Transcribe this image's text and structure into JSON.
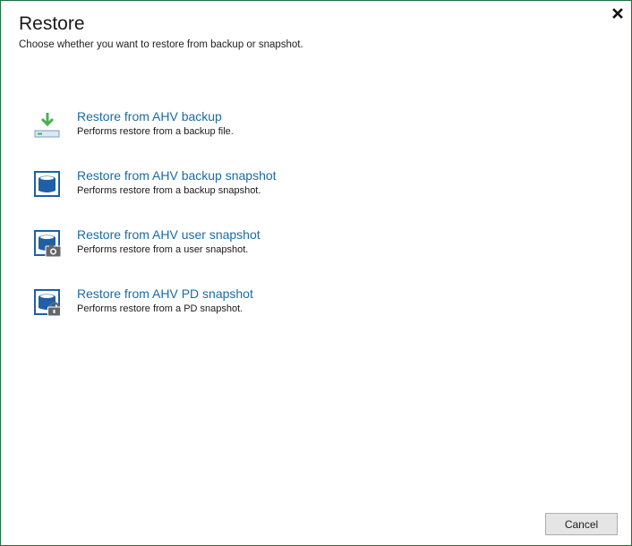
{
  "dialog": {
    "title": "Restore",
    "subtitle": "Choose whether you want to restore from backup or snapshot."
  },
  "options": [
    {
      "title": "Restore from AHV backup",
      "description": "Performs restore from a backup file.",
      "icon": "backup-download-icon"
    },
    {
      "title": "Restore from AHV backup snapshot",
      "description": "Performs restore from a backup snapshot.",
      "icon": "database-icon"
    },
    {
      "title": "Restore from AHV user snapshot",
      "description": "Performs restore from a user snapshot.",
      "icon": "database-camera-icon"
    },
    {
      "title": "Restore from AHV PD snapshot",
      "description": "Performs restore from a PD snapshot.",
      "icon": "database-lock-icon"
    }
  ],
  "footer": {
    "cancel_label": "Cancel"
  },
  "colors": {
    "accent": "#1a6ca2",
    "icon_blue": "#1f5fa8",
    "icon_green": "#4caf50",
    "border": "#1e6f3f"
  }
}
